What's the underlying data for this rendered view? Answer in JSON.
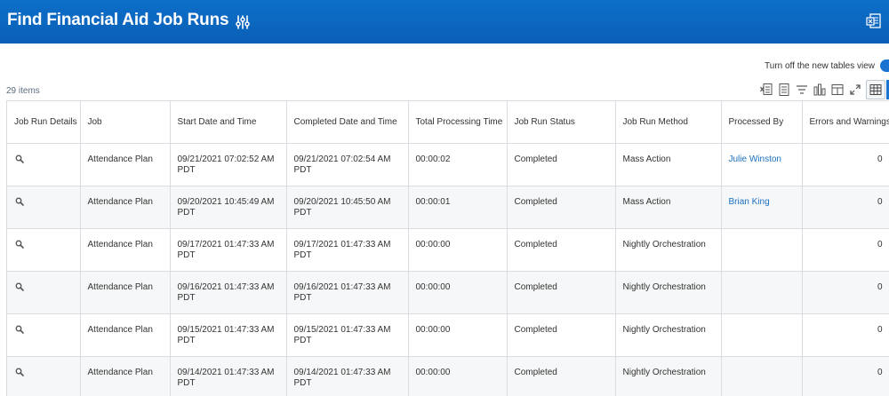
{
  "header": {
    "title": "Find Financial Aid Job Runs"
  },
  "toggle": {
    "label": "Turn off the new tables view"
  },
  "items_count": "29 items",
  "columns": [
    "Job Run Details",
    "Job",
    "Start Date and Time",
    "Completed Date and Time",
    "Total Processing Time",
    "Job Run Status",
    "Job Run Method",
    "Processed By",
    "Errors and Warnings"
  ],
  "rows": [
    {
      "job": "Attendance Plan",
      "start": "09/21/2021 07:02:52 AM",
      "start_tz": "PDT",
      "completed": "09/21/2021 07:02:54 AM",
      "completed_tz": "PDT",
      "processing": "00:00:02",
      "status": "Completed",
      "method": "Mass Action",
      "processed_by": "Julie Winston",
      "errors": "0"
    },
    {
      "job": "Attendance Plan",
      "start": "09/20/2021 10:45:49 AM",
      "start_tz": "PDT",
      "completed": "09/20/2021 10:45:50 AM",
      "completed_tz": "PDT",
      "processing": "00:00:01",
      "status": "Completed",
      "method": "Mass Action",
      "processed_by": "Brian King",
      "errors": "0"
    },
    {
      "job": "Attendance Plan",
      "start": "09/17/2021 01:47:33 AM",
      "start_tz": "PDT",
      "completed": "09/17/2021 01:47:33 AM",
      "completed_tz": "PDT",
      "processing": "00:00:00",
      "status": "Completed",
      "method": "Nightly Orchestration",
      "processed_by": "",
      "errors": "0"
    },
    {
      "job": "Attendance Plan",
      "start": "09/16/2021 01:47:33 AM",
      "start_tz": "PDT",
      "completed": "09/16/2021 01:47:33 AM",
      "completed_tz": "PDT",
      "processing": "00:00:00",
      "status": "Completed",
      "method": "Nightly Orchestration",
      "processed_by": "",
      "errors": "0"
    },
    {
      "job": "Attendance Plan",
      "start": "09/15/2021 01:47:33 AM",
      "start_tz": "PDT",
      "completed": "09/15/2021 01:47:33 AM",
      "completed_tz": "PDT",
      "processing": "00:00:00",
      "status": "Completed",
      "method": "Nightly Orchestration",
      "processed_by": "",
      "errors": "0"
    },
    {
      "job": "Attendance Plan",
      "start": "09/14/2021 01:47:33 AM",
      "start_tz": "PDT",
      "completed": "09/14/2021 01:47:33 AM",
      "completed_tz": "PDT",
      "processing": "00:00:00",
      "status": "Completed",
      "method": "Nightly Orchestration",
      "processed_by": "",
      "errors": "0"
    }
  ],
  "icons": {
    "config": "sliders-icon",
    "export": "export-excel-icon",
    "details": "magnifier-icon"
  },
  "colors": {
    "header_bg": "#0a66c2",
    "link": "#1a6fbf",
    "accent": "#1a73d1"
  }
}
